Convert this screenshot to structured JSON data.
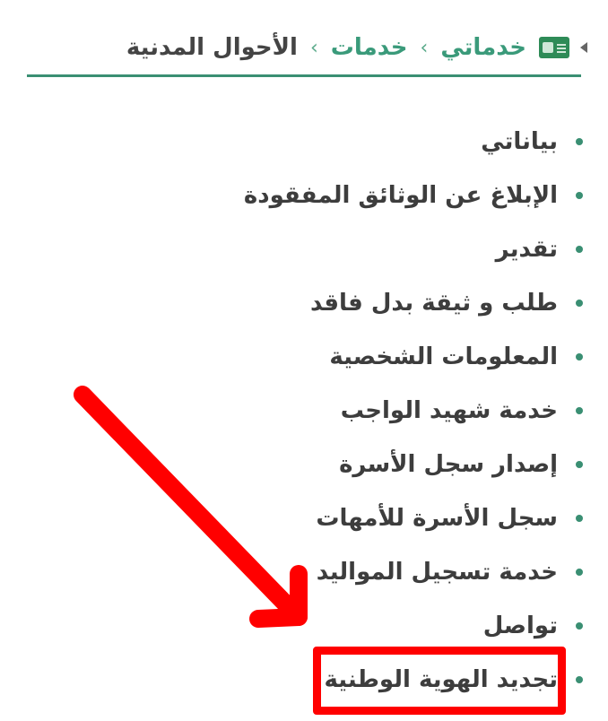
{
  "breadcrumb": {
    "items": [
      "خدماتي",
      "خدمات",
      "الأحوال المدنية"
    ],
    "separator": "›"
  },
  "menu": {
    "items": [
      "بياناتي",
      "الإبلاغ عن الوثائق المفقودة",
      "تقدير",
      "طلب و ثيقة بدل فاقد",
      "المعلومات الشخصية",
      "خدمة شهيد الواجب",
      "إصدار سجل الأسرة",
      "سجل الأسرة للأمهات",
      "خدمة تسجيل المواليد",
      "تواصل",
      "تجديد الهوية الوطنية"
    ]
  },
  "annotation": {
    "color": "#ff0000",
    "highlighted_item": "تجديد الهوية الوطنية"
  },
  "colors": {
    "accent": "#3a8f73",
    "text": "#3d3d3d"
  }
}
